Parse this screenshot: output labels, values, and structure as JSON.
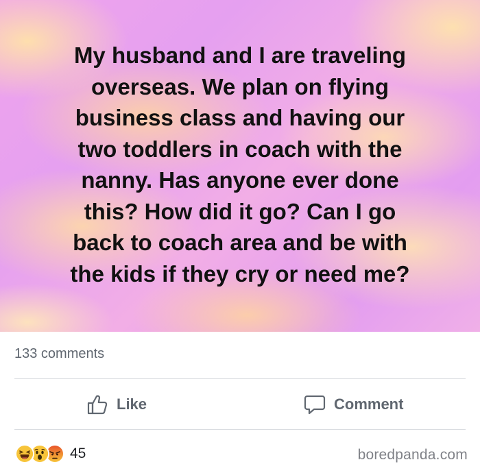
{
  "post": {
    "lines": [
      "My husband and I are traveling",
      "overseas. We plan on flying",
      "business class and having our",
      "two toddlers in coach with the",
      "nanny. Has anyone ever done",
      "this?  How did it go?  Can I go",
      "back to coach area and be with",
      "the kids if they cry or need me?"
    ]
  },
  "stats": {
    "comments": "133 comments",
    "reaction_count": "45",
    "reaction_icons": [
      "laughing-face-icon",
      "surprised-face-icon",
      "angry-face-icon"
    ]
  },
  "actions": {
    "like_label": "Like",
    "comment_label": "Comment"
  },
  "watermark": "boredpanda.com",
  "colors": {
    "meta_text": "#606770",
    "divider": "#dadde1",
    "reaction_yellow": "#f7c43a",
    "reaction_angry": "#e8542a"
  }
}
